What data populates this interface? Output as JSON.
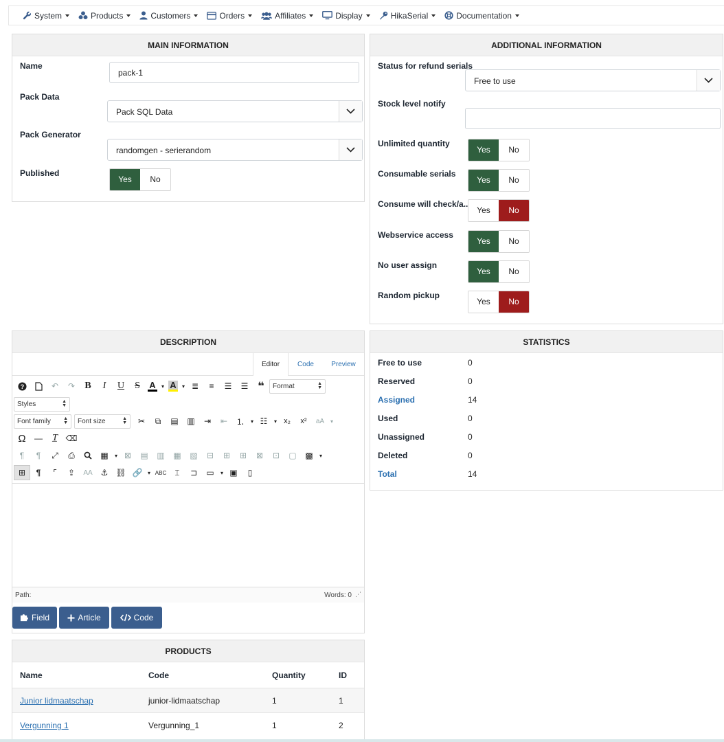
{
  "nav": {
    "items": [
      {
        "label": "System",
        "icon": "wrench-icon"
      },
      {
        "label": "Products",
        "icon": "cubes-icon"
      },
      {
        "label": "Customers",
        "icon": "user-icon"
      },
      {
        "label": "Orders",
        "icon": "credit-card-icon"
      },
      {
        "label": "Affiliates",
        "icon": "users-icon"
      },
      {
        "label": "Display",
        "icon": "desktop-icon"
      },
      {
        "label": "HikaSerial",
        "icon": "key-icon"
      },
      {
        "label": "Documentation",
        "icon": "life-ring-icon"
      }
    ]
  },
  "main_info": {
    "title": "MAIN INFORMATION",
    "name_label": "Name",
    "name_value": "pack-1",
    "pack_data_label": "Pack Data",
    "pack_data_value": "Pack SQL Data",
    "pack_generator_label": "Pack Generator",
    "pack_generator_value": "randomgen - serierandom",
    "published_label": "Published",
    "published_value": "Yes"
  },
  "toggle": {
    "yes": "Yes",
    "no": "No"
  },
  "additional": {
    "title": "ADDITIONAL INFORMATION",
    "refund_label": "Status for refund serials",
    "refund_value": "Free to use",
    "stock_label": "Stock level notify",
    "stock_value": "",
    "unlimited_label": "Unlimited quantity",
    "unlimited_value": "Yes",
    "consumable_label": "Consumable serials",
    "consumable_value": "Yes",
    "consume_check_label": "Consume will check/a...",
    "consume_check_value": "No",
    "webservice_label": "Webservice access",
    "webservice_value": "Yes",
    "no_user_label": "No user assign",
    "no_user_value": "Yes",
    "random_label": "Random pickup",
    "random_value": "No"
  },
  "description": {
    "title": "DESCRIPTION",
    "tabs": [
      "Editor",
      "Code",
      "Preview"
    ],
    "format_label": "Format",
    "styles_label": "Styles",
    "font_family_label": "Font family",
    "font_size_label": "Font size",
    "path_label": "Path:",
    "words_label": "Words: 0"
  },
  "buttons": {
    "field": "Field",
    "article": "Article",
    "code": "Code"
  },
  "statistics": {
    "title": "STATISTICS",
    "rows": [
      {
        "label": "Free to use",
        "value": "0"
      },
      {
        "label": "Reserved",
        "value": "0"
      },
      {
        "label": "Assigned",
        "value": "14"
      },
      {
        "label": "Used",
        "value": "0"
      },
      {
        "label": "Unassigned",
        "value": "0"
      },
      {
        "label": "Deleted",
        "value": "0"
      },
      {
        "label": "Total",
        "value": "14"
      }
    ]
  },
  "products": {
    "title": "PRODUCTS",
    "headers": [
      "Name",
      "Code",
      "Quantity",
      "ID"
    ],
    "rows": [
      {
        "name": "Junior lidmaatschap",
        "code": "junior-lidmaatschap",
        "quantity": "1",
        "id": "1"
      },
      {
        "name": "Vergunning 1",
        "code": "Vergunning_1",
        "quantity": "1",
        "id": "2"
      }
    ]
  },
  "colors": {
    "yes_active": "#2f5f3e",
    "no_active": "#9e1c1c",
    "button_blue": "#3b5e8e",
    "link": "#2a6fb0"
  }
}
